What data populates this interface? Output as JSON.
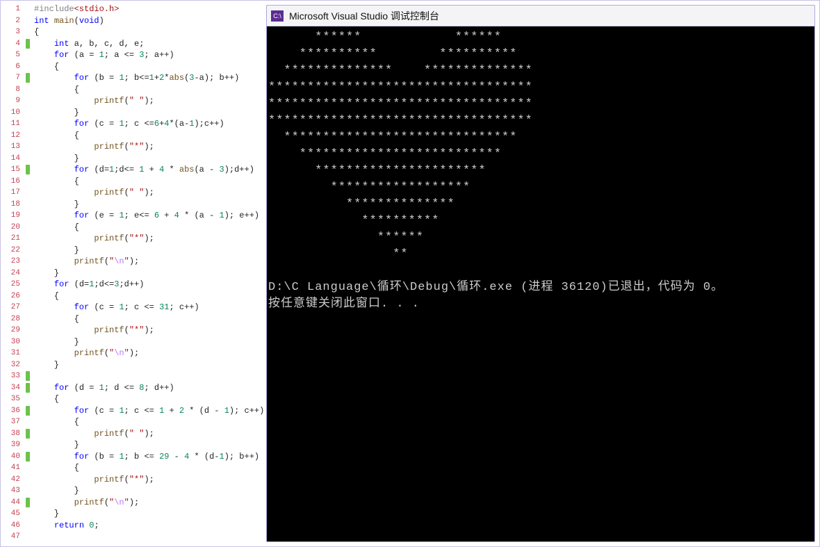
{
  "console": {
    "icon_text": "C:\\",
    "title": "Microsoft Visual Studio 调试控制台",
    "art": [
      "      ******            ******",
      "    **********        **********",
      "  **************    **************",
      "**********************************",
      "**********************************",
      "**********************************",
      "  ******************************",
      "    **************************",
      "      **********************",
      "        ******************",
      "          **************",
      "            **********",
      "              ******",
      "                **"
    ],
    "status1": "D:\\C Language\\循环\\Debug\\循环.exe (进程 36120)已退出，代码为 0。",
    "status2": "按任意键关闭此窗口. . ."
  },
  "editor": {
    "gutter": [
      {
        "n": "1",
        "m": ""
      },
      {
        "n": "2",
        "m": ""
      },
      {
        "n": "3",
        "m": ""
      },
      {
        "n": "4",
        "m": "green"
      },
      {
        "n": "5",
        "m": ""
      },
      {
        "n": "6",
        "m": ""
      },
      {
        "n": "7",
        "m": "green"
      },
      {
        "n": "8",
        "m": ""
      },
      {
        "n": "9",
        "m": ""
      },
      {
        "n": "10",
        "m": ""
      },
      {
        "n": "11",
        "m": ""
      },
      {
        "n": "12",
        "m": ""
      },
      {
        "n": "13",
        "m": ""
      },
      {
        "n": "14",
        "m": ""
      },
      {
        "n": "15",
        "m": "green"
      },
      {
        "n": "16",
        "m": ""
      },
      {
        "n": "17",
        "m": ""
      },
      {
        "n": "18",
        "m": ""
      },
      {
        "n": "19",
        "m": ""
      },
      {
        "n": "20",
        "m": ""
      },
      {
        "n": "21",
        "m": ""
      },
      {
        "n": "22",
        "m": ""
      },
      {
        "n": "23",
        "m": ""
      },
      {
        "n": "24",
        "m": ""
      },
      {
        "n": "25",
        "m": ""
      },
      {
        "n": "26",
        "m": ""
      },
      {
        "n": "27",
        "m": ""
      },
      {
        "n": "28",
        "m": ""
      },
      {
        "n": "29",
        "m": ""
      },
      {
        "n": "30",
        "m": ""
      },
      {
        "n": "31",
        "m": ""
      },
      {
        "n": "32",
        "m": ""
      },
      {
        "n": "33",
        "m": "green"
      },
      {
        "n": "34",
        "m": "green"
      },
      {
        "n": "35",
        "m": ""
      },
      {
        "n": "36",
        "m": "green"
      },
      {
        "n": "37",
        "m": ""
      },
      {
        "n": "38",
        "m": "green"
      },
      {
        "n": "39",
        "m": ""
      },
      {
        "n": "40",
        "m": "green"
      },
      {
        "n": "41",
        "m": ""
      },
      {
        "n": "42",
        "m": ""
      },
      {
        "n": "43",
        "m": ""
      },
      {
        "n": "44",
        "m": "green"
      },
      {
        "n": "45",
        "m": ""
      },
      {
        "n": "46",
        "m": ""
      },
      {
        "n": "47",
        "m": ""
      }
    ],
    "lines": [
      [
        [
          "pp",
          "#include"
        ],
        [
          "inc",
          "<stdio.h>"
        ]
      ],
      [
        [
          "kw",
          "int "
        ],
        [
          "fn",
          "main"
        ],
        [
          "",
          "("
        ],
        [
          "kw",
          "void"
        ],
        [
          "",
          ")"
        ]
      ],
      [
        [
          "",
          "{"
        ]
      ],
      [
        [
          "",
          "    "
        ],
        [
          "kw",
          "int"
        ],
        [
          "",
          " a, b, c, d, e;"
        ]
      ],
      [
        [
          "",
          "    "
        ],
        [
          "kw",
          "for"
        ],
        [
          "",
          " (a = 1; a <= 3; a++)"
        ]
      ],
      [
        [
          "",
          "    {"
        ]
      ],
      [
        [
          "",
          "        "
        ],
        [
          "kw",
          "for"
        ],
        [
          "",
          " (b = 1; b<=1+2*"
        ],
        [
          "fn",
          "abs"
        ],
        [
          "",
          "(3-a); b++)"
        ]
      ],
      [
        [
          "",
          "        {"
        ]
      ],
      [
        [
          "",
          "            "
        ],
        [
          "fn",
          "printf"
        ],
        [
          "",
          "("
        ],
        [
          "str",
          "\" \""
        ],
        [
          "",
          ");"
        ]
      ],
      [
        [
          "",
          "        }"
        ]
      ],
      [
        [
          "",
          "        "
        ],
        [
          "kw",
          "for"
        ],
        [
          "",
          " (c = 1; c <=6+4*(a-1);c++)"
        ]
      ],
      [
        [
          "",
          "        {"
        ]
      ],
      [
        [
          "",
          "            "
        ],
        [
          "fn",
          "printf"
        ],
        [
          "",
          "("
        ],
        [
          "str",
          "\"*\""
        ],
        [
          "",
          ");"
        ]
      ],
      [
        [
          "",
          "        }"
        ]
      ],
      [
        [
          "",
          "        "
        ],
        [
          "kw",
          "for"
        ],
        [
          "",
          " (d=1;d<= 1 + 4 * "
        ],
        [
          "fn",
          "abs"
        ],
        [
          "",
          "(a - 3);d++)"
        ]
      ],
      [
        [
          "",
          "        {"
        ]
      ],
      [
        [
          "",
          "            "
        ],
        [
          "fn",
          "printf"
        ],
        [
          "",
          "("
        ],
        [
          "str",
          "\" \""
        ],
        [
          "",
          ");"
        ]
      ],
      [
        [
          "",
          "        }"
        ]
      ],
      [
        [
          "",
          "        "
        ],
        [
          "kw",
          "for"
        ],
        [
          "",
          " (e = 1; e<= 6 + 4 * (a - 1); e++)"
        ]
      ],
      [
        [
          "",
          "        {"
        ]
      ],
      [
        [
          "",
          "            "
        ],
        [
          "fn",
          "printf"
        ],
        [
          "",
          "("
        ],
        [
          "str",
          "\"*\""
        ],
        [
          "",
          ");"
        ]
      ],
      [
        [
          "",
          "        }"
        ]
      ],
      [
        [
          "",
          "        "
        ],
        [
          "fn",
          "printf"
        ],
        [
          "",
          "("
        ],
        [
          "str",
          "\""
        ],
        [
          "esc",
          "\\n"
        ],
        [
          "str",
          "\""
        ],
        [
          "",
          ");"
        ]
      ],
      [
        [
          "",
          "    }"
        ]
      ],
      [
        [
          "",
          "    "
        ],
        [
          "kw",
          "for"
        ],
        [
          "",
          " (d=1;d<=3;d++)"
        ]
      ],
      [
        [
          "",
          "    {"
        ]
      ],
      [
        [
          "",
          "        "
        ],
        [
          "kw",
          "for"
        ],
        [
          "",
          " (c = 1; c <= 31; c++)"
        ]
      ],
      [
        [
          "",
          "        {"
        ]
      ],
      [
        [
          "",
          "            "
        ],
        [
          "fn",
          "printf"
        ],
        [
          "",
          "("
        ],
        [
          "str",
          "\"*\""
        ],
        [
          "",
          ");"
        ]
      ],
      [
        [
          "",
          "        }"
        ]
      ],
      [
        [
          "",
          "        "
        ],
        [
          "fn",
          "printf"
        ],
        [
          "",
          "("
        ],
        [
          "str",
          "\""
        ],
        [
          "esc",
          "\\n"
        ],
        [
          "str",
          "\""
        ],
        [
          "",
          ");"
        ]
      ],
      [
        [
          "",
          "    }"
        ]
      ],
      [
        [
          "",
          ""
        ]
      ],
      [
        [
          "",
          "    "
        ],
        [
          "kw",
          "for"
        ],
        [
          "",
          " (d = 1; d <= 8; d++)"
        ]
      ],
      [
        [
          "",
          "    {"
        ]
      ],
      [
        [
          "",
          "        "
        ],
        [
          "kw",
          "for"
        ],
        [
          "",
          " (c = 1; c <= 1 + 2 * (d - 1); c++)"
        ]
      ],
      [
        [
          "",
          "        {"
        ]
      ],
      [
        [
          "",
          "            "
        ],
        [
          "fn",
          "printf"
        ],
        [
          "",
          "("
        ],
        [
          "str",
          "\" \""
        ],
        [
          "",
          ");"
        ]
      ],
      [
        [
          "",
          "        }"
        ]
      ],
      [
        [
          "",
          "        "
        ],
        [
          "kw",
          "for"
        ],
        [
          "",
          " (b = 1; b <= 29 - 4 * (d-1); b++)"
        ]
      ],
      [
        [
          "",
          "        {"
        ]
      ],
      [
        [
          "",
          "            "
        ],
        [
          "fn",
          "printf"
        ],
        [
          "",
          "("
        ],
        [
          "str",
          "\"*\""
        ],
        [
          "",
          ");"
        ]
      ],
      [
        [
          "",
          "        }"
        ]
      ],
      [
        [
          "",
          "        "
        ],
        [
          "fn",
          "printf"
        ],
        [
          "",
          "("
        ],
        [
          "str",
          "\""
        ],
        [
          "esc",
          "\\n"
        ],
        [
          "str",
          "\""
        ],
        [
          "",
          ");"
        ]
      ],
      [
        [
          "",
          "    }"
        ]
      ],
      [
        [
          "",
          "    "
        ],
        [
          "kw",
          "return"
        ],
        [
          "",
          " 0;"
        ]
      ],
      [
        [
          "",
          ""
        ]
      ]
    ]
  }
}
